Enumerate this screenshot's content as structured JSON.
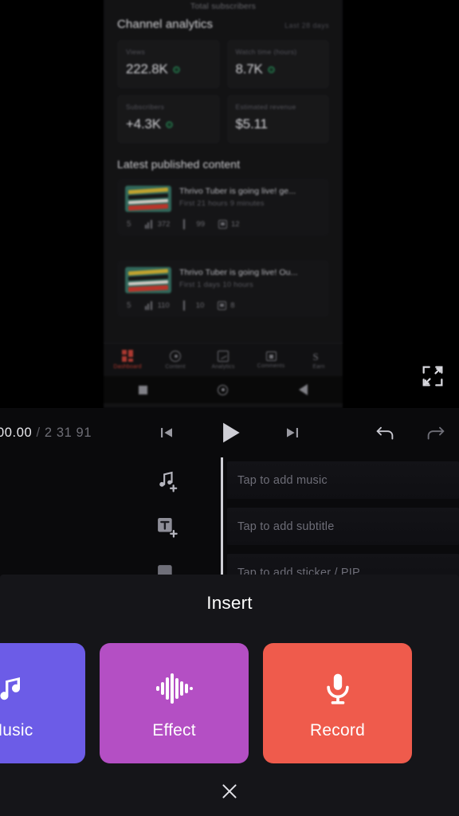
{
  "preview": {
    "partial_top_text": "Total subscribers",
    "analytics": {
      "section_title": "Channel analytics",
      "date_range": "Last 28 days",
      "cards": [
        {
          "label": "Views",
          "value": "222.8K",
          "has_dot": true
        },
        {
          "label": "Watch time (hours)",
          "value": "8.7K",
          "has_dot": true
        },
        {
          "label": "Subscribers",
          "value": "+4.3K",
          "has_dot": true
        },
        {
          "label": "Estimated revenue",
          "value": "$5.11",
          "has_dot": false
        }
      ]
    },
    "content": {
      "section_title": "Latest published content",
      "items": [
        {
          "title": "Thrivo Tuber is going live! ge...",
          "subtitle": "First 21 hours 9 minutes",
          "stats": {
            "views": "372",
            "likes": "99",
            "comments": "12"
          }
        },
        {
          "title": "Thrivo Tuber is going live! Ou...",
          "subtitle": "First 1 days 10 hours",
          "stats": {
            "views": "110",
            "likes": "10",
            "comments": "8"
          }
        }
      ]
    },
    "bottom_nav": [
      {
        "label": "Dashboard",
        "icon": "dashboard-icon",
        "active": true
      },
      {
        "label": "Content",
        "icon": "content-ring-icon",
        "active": false
      },
      {
        "label": "Analytics",
        "icon": "analytics-icon",
        "active": false
      },
      {
        "label": "Comments",
        "icon": "comments-icon",
        "active": false
      },
      {
        "label": "Earn",
        "icon": "earn-icon",
        "active": false
      }
    ],
    "android_nav": [
      "recents-square-icon",
      "home-circle-icon",
      "back-triangle-icon"
    ],
    "fullscreen_icon": "fullscreen-expand-icon"
  },
  "transport": {
    "current_time": "00.00",
    "separator": "/",
    "total_time": "2 31 91",
    "prev_icon": "skip-previous-icon",
    "play_icon": "play-icon",
    "next_icon": "skip-next-icon",
    "undo_icon": "undo-icon",
    "redo_icon": "redo-icon"
  },
  "timeline": {
    "tracks": [
      {
        "icon": "add-music-icon",
        "placeholder": "Tap to add music"
      },
      {
        "icon": "add-subtitle-icon",
        "placeholder": "Tap to add subtitle"
      },
      {
        "icon": "add-sticker-icon",
        "placeholder": "Tap to add sticker / PIP"
      }
    ]
  },
  "sheet": {
    "title": "Insert",
    "cards": [
      {
        "label": "Music",
        "icon": "music-note-icon",
        "color": "#6c5ce7"
      },
      {
        "label": "Effect",
        "icon": "waveform-icon",
        "color": "#b44fc4"
      },
      {
        "label": "Record",
        "icon": "microphone-icon",
        "color": "#ef5b4c"
      }
    ],
    "close_icon": "close-icon"
  }
}
